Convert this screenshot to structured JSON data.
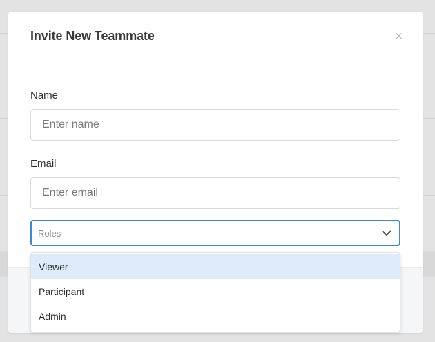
{
  "modal": {
    "title": "Invite New Teammate",
    "close_label": "×"
  },
  "form": {
    "name_label": "Name",
    "name_placeholder": "Enter name",
    "name_value": "",
    "email_label": "Email",
    "email_placeholder": "Enter email",
    "email_value": "",
    "roles_placeholder": "Roles"
  },
  "roles_menu": {
    "items": [
      {
        "label": "Viewer",
        "highlighted": true
      },
      {
        "label": "Participant",
        "highlighted": false
      },
      {
        "label": "Admin",
        "highlighted": false
      }
    ]
  },
  "icons": {
    "close": "close-icon",
    "dropdown": "chevron-down-icon"
  },
  "colors": {
    "accent": "#3b8ad0",
    "highlight": "#deebfb"
  }
}
